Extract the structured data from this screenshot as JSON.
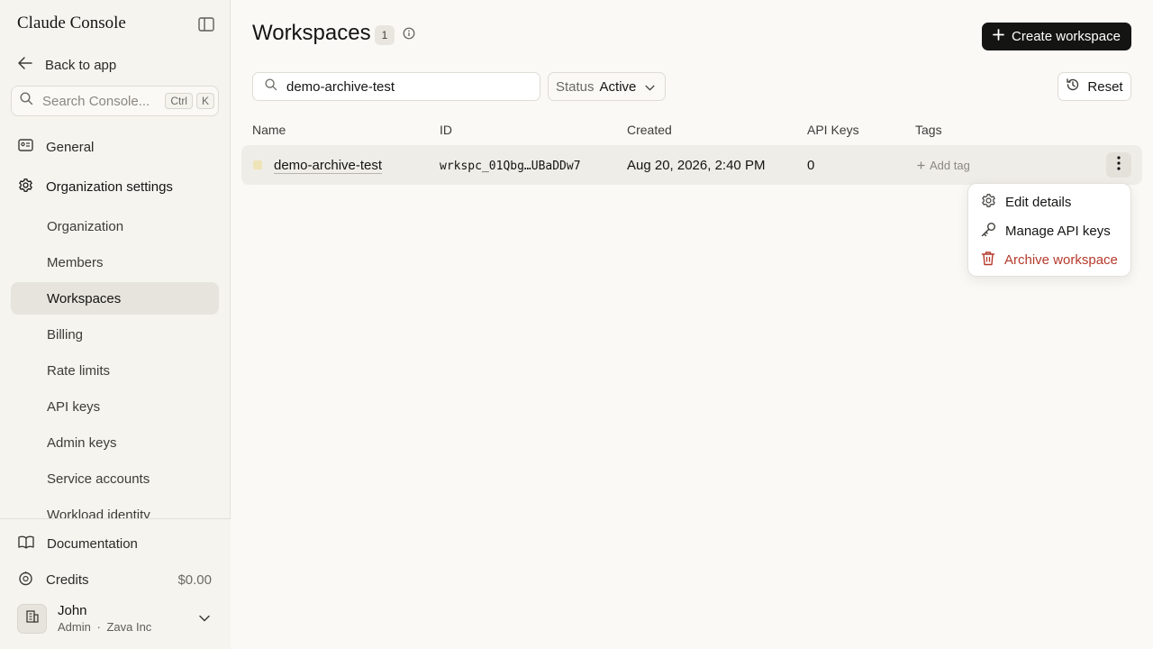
{
  "sidebar": {
    "brand": "Claude Console",
    "back_label": "Back to app",
    "search_placeholder": "Search Console...",
    "search_shortcut": [
      "Ctrl",
      "K"
    ],
    "general_label": "General",
    "org_settings_label": "Organization settings",
    "sub_items": [
      {
        "label": "Organization"
      },
      {
        "label": "Members"
      },
      {
        "label": "Workspaces"
      },
      {
        "label": "Billing"
      },
      {
        "label": "Rate limits"
      },
      {
        "label": "API keys"
      },
      {
        "label": "Admin keys"
      },
      {
        "label": "Service accounts"
      },
      {
        "label": "Workload identity"
      }
    ],
    "active_item": "Workspaces",
    "footer": {
      "documentation_label": "Documentation",
      "credits_label": "Credits",
      "credits_value": "$0.00",
      "user_name": "John",
      "user_role": "Admin",
      "user_org": "Zava Inc",
      "user_separator": "·"
    }
  },
  "main": {
    "title": "Workspaces",
    "count": "1",
    "create_button": "Create workspace",
    "search_value": "demo-archive-test",
    "status_label": "Status",
    "status_value": "Active",
    "reset_button": "Reset",
    "columns": [
      "Name",
      "ID",
      "Created",
      "API Keys",
      "Tags"
    ],
    "rows": [
      {
        "name": "demo-archive-test",
        "id": "wrkspc_01Qbg…UBaDDw7",
        "created": "Aug 20, 2026, 2:40 PM",
        "api_keys": "0",
        "add_tag": "Add tag"
      }
    ],
    "row_menu": {
      "edit": "Edit details",
      "manage_keys": "Manage API keys",
      "archive": "Archive workspace"
    }
  },
  "colors": {
    "background": "#faf9f5",
    "sidebar": "#f5f4ef",
    "primary_button": "#141413",
    "danger": "#b53a2b",
    "workspace_swatch": "#efe3b8"
  }
}
